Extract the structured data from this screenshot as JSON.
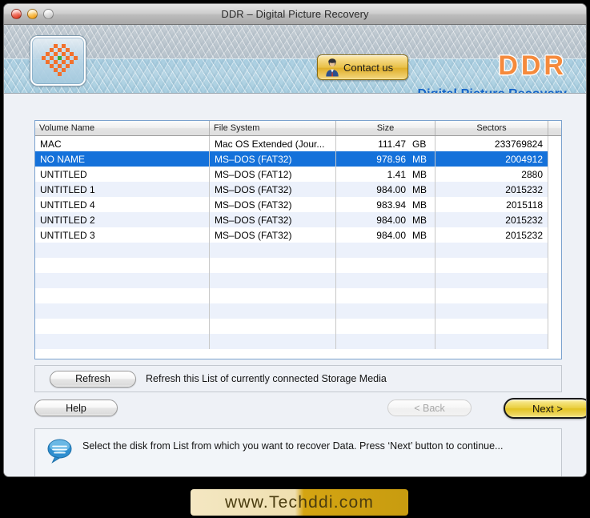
{
  "window": {
    "title": "DDR – Digital Picture Recovery",
    "traffic_lights": [
      "close-button",
      "minimize-button",
      "zoom-button"
    ]
  },
  "banner": {
    "app_icon": "ddr-checker-flower-icon",
    "contact_button": {
      "label": "Contact us",
      "icon": "person-icon"
    },
    "brand": "DDR",
    "brand_sub": "Digital Picture Recovery",
    "brand_color": "#f58a3c",
    "brand_sub_color": "#1464c8"
  },
  "table": {
    "columns": [
      "Volume Name",
      "File System",
      "Size",
      "Sectors"
    ],
    "rows": [
      {
        "volume": "MAC",
        "fs": "Mac OS Extended (Jour...",
        "size_num": "111.47",
        "size_unit": "GB",
        "sectors": "233769824",
        "selected": false
      },
      {
        "volume": "NO NAME",
        "fs": "MS–DOS (FAT32)",
        "size_num": "978.96",
        "size_unit": "MB",
        "sectors": "2004912",
        "selected": true
      },
      {
        "volume": "UNTITLED",
        "fs": "MS–DOS (FAT12)",
        "size_num": "1.41",
        "size_unit": "MB",
        "sectors": "2880",
        "selected": false
      },
      {
        "volume": "UNTITLED 1",
        "fs": "MS–DOS (FAT32)",
        "size_num": "984.00",
        "size_unit": "MB",
        "sectors": "2015232",
        "selected": false
      },
      {
        "volume": "UNTITLED 4",
        "fs": "MS–DOS (FAT32)",
        "size_num": "983.94",
        "size_unit": "MB",
        "sectors": "2015118",
        "selected": false
      },
      {
        "volume": "UNTITLED 2",
        "fs": "MS–DOS (FAT32)",
        "size_num": "984.00",
        "size_unit": "MB",
        "sectors": "2015232",
        "selected": false
      },
      {
        "volume": "UNTITLED 3",
        "fs": "MS–DOS (FAT32)",
        "size_num": "984.00",
        "size_unit": "MB",
        "sectors": "2015232",
        "selected": false
      }
    ],
    "empty_row_count": 7,
    "selection_color": "#1471da",
    "stripe_color": "#ecf1fb"
  },
  "refresh": {
    "button_label": "Refresh",
    "note": "Refresh this List of currently connected Storage Media"
  },
  "nav": {
    "help_label": "Help",
    "back_label": "< Back",
    "back_disabled": true,
    "next_label": "Next >",
    "next_color": "#e9ce3c"
  },
  "status": {
    "icon": "speech-bubble-icon",
    "message": "Select the disk from List from which you want to recover Data. Press ‘Next’ button to continue..."
  },
  "watermark": {
    "text": "www.Techddi.com"
  }
}
